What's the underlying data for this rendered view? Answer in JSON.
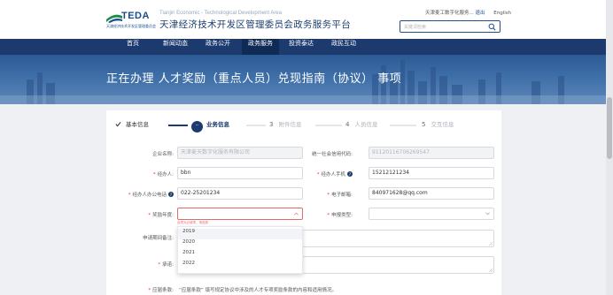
{
  "header": {
    "logo_text": "TEDA",
    "logo_sub": "天津经济技术开发区管理委员会",
    "site_en": "Tianjin Economic - Technological Development Area",
    "site_cn": "天津经济技术开发区管理委员会政务服务平台",
    "user_company": "天津麦工数字化服务...",
    "logout": "退出",
    "lang": "English",
    "search_placeholder": "关键词检索"
  },
  "nav": {
    "items": [
      {
        "label": "首页"
      },
      {
        "label": "新闻动态"
      },
      {
        "label": "政务公开"
      },
      {
        "label": "政务服务",
        "active": true
      },
      {
        "label": "投资泰达"
      },
      {
        "label": "政民互动"
      }
    ]
  },
  "banner": {
    "title": "正在办理 人才奖励（重点人员）兑现指南（协议） 事项"
  },
  "steps": [
    {
      "num": "",
      "label": "基本信息",
      "state": "done"
    },
    {
      "num": "···",
      "label": "业务信息",
      "state": "active"
    },
    {
      "num": "3",
      "label": "附件信息",
      "state": "pending"
    },
    {
      "num": "4",
      "label": "人员信息",
      "state": "pending"
    },
    {
      "num": "5",
      "label": "交互信息",
      "state": "pending"
    }
  ],
  "form": {
    "company_label": "企业名称:",
    "company_value": "天津麦天数字化服务有限公司",
    "credit_label": "统一社会信用代码:",
    "credit_value": "91120116706269547",
    "handler_label": "经办人:",
    "handler_value": "bbn",
    "handler_phone_label": "经办人手机",
    "handler_phone_value": "15212121234",
    "office_phone_label": "经办人办公电话",
    "office_phone_value": "022-25201234",
    "email_label": "电子邮箱:",
    "email_value": "840971628@qq.com",
    "year_label": "奖励年度:",
    "year_error": "此项为必填项，请选择",
    "apply_type_label": "申报类型:",
    "period_label": "申请期间备注:",
    "other_label": "承诺:",
    "commit_label": "应届条款:",
    "commit_text": "“应届条款” 填写规定协议中涉及的人才专项奖励条款的内容和适用情况。"
  },
  "year_options": [
    "2019",
    "2020",
    "2021",
    "2022"
  ],
  "colors": {
    "primary": "#1c3a6e",
    "error": "#e26a6a",
    "required": "#d93a3a"
  }
}
